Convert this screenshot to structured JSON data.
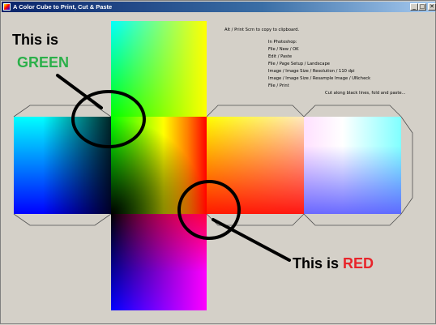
{
  "window": {
    "title": "A Color Cube to Print, Cut & Paste",
    "buttons": {
      "minimize": "_",
      "maximize": "□",
      "close": "✕"
    }
  },
  "instructions": {
    "title": "Alt / Print Scrn to copy to clipboard.",
    "steps": [
      "In Photoshop:",
      "File / New / OK",
      "Edit / Paste",
      "File / Page Setup / Landscape",
      "Image / Image Size / Resolution / 110 dpi",
      "Image / Image Size / Resample Image / UNcheck",
      "File / Print"
    ],
    "note": "Cut along black lines, fold and paste..."
  },
  "annotations": {
    "green": {
      "prefix": "This is",
      "word": "GREEN",
      "word_color": "#2bb04a"
    },
    "red": {
      "prefix": "This is ",
      "word": "RED",
      "word_color": "#e8242a"
    }
  },
  "cube": {
    "faces": [
      "top",
      "left",
      "center",
      "right-1",
      "right-2",
      "bottom"
    ],
    "fold_flap_color": "#d4d0c8",
    "cut_line_color": "#404040"
  }
}
